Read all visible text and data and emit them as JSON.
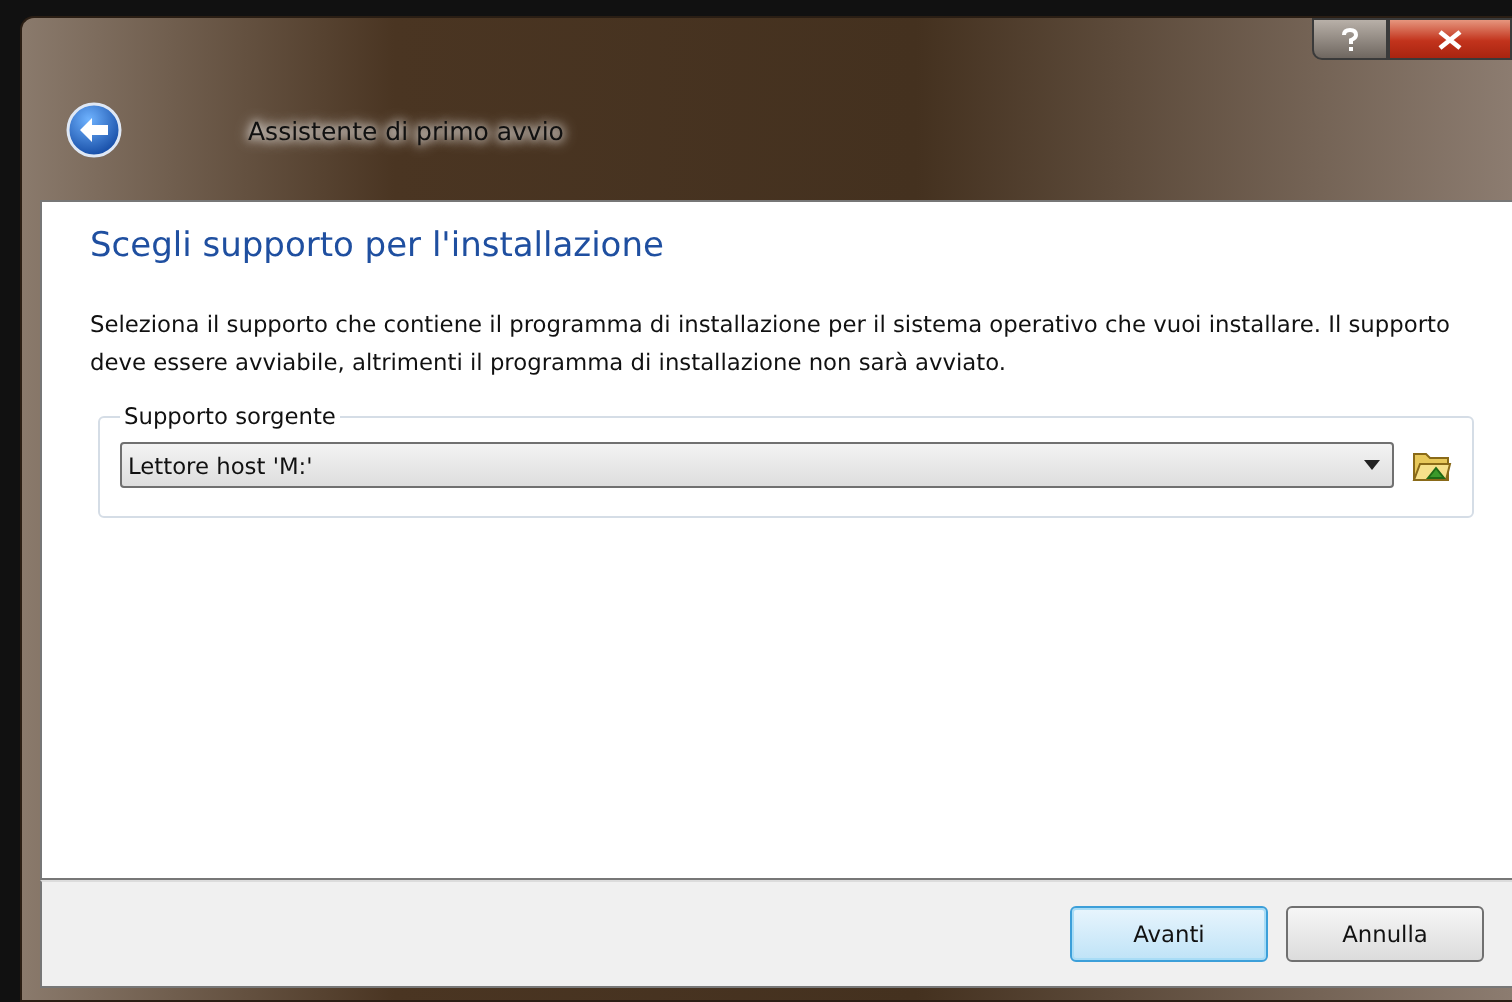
{
  "window": {
    "title": "Assistente di primo avvio"
  },
  "page": {
    "heading": "Scegli supporto per l'installazione",
    "description": "Seleziona il supporto che contiene il programma di installazione per il sistema operativo che vuoi installare. Il supporto deve essere avviabile, altrimenti il programma di installazione non sarà avviato."
  },
  "source_group": {
    "label": "Supporto sorgente",
    "value": "Lettore host 'M:'"
  },
  "buttons": [
    {
      "label": "Avanti",
      "default": true
    },
    {
      "label": "Annulla",
      "default": false
    }
  ]
}
